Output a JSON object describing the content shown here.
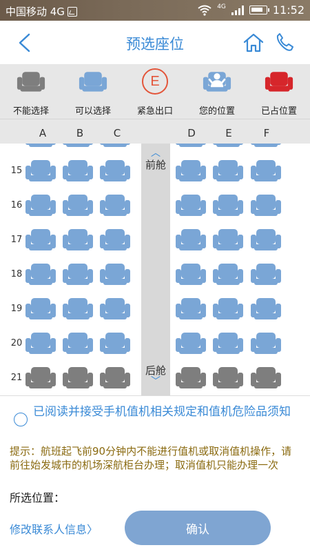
{
  "status_bar": {
    "carrier": "中国移动 4G",
    "network": "4G",
    "time": "11:52"
  },
  "header": {
    "title": "预选座位",
    "back_icon": "chevron-left-icon",
    "home_icon": "home-icon",
    "phone_icon": "phone-icon"
  },
  "legend": [
    {
      "label": "不能选择",
      "icon": "seat-gray-icon",
      "color": "#7e7e7e"
    },
    {
      "label": "可以选择",
      "icon": "seat-blue-icon",
      "color": "#7aa6d6"
    },
    {
      "label": "紧急出口",
      "icon": "exit-icon",
      "symbol": "E",
      "color": "#e3553a"
    },
    {
      "label": "您的位置",
      "icon": "seat-person-icon",
      "color": "#7aa6d6"
    },
    {
      "label": "已占位置",
      "icon": "seat-red-icon",
      "color": "#d6262b"
    }
  ],
  "columns": [
    "A",
    "B",
    "C",
    "D",
    "E",
    "F"
  ],
  "cabin": {
    "front_label": "前舱",
    "rear_label": "后舱"
  },
  "rows": [
    {
      "num": "15",
      "seats": [
        "available",
        "available",
        "available",
        "available",
        "available",
        "available"
      ]
    },
    {
      "num": "16",
      "seats": [
        "available",
        "available",
        "available",
        "available",
        "available",
        "available"
      ]
    },
    {
      "num": "17",
      "seats": [
        "available",
        "available",
        "available",
        "available",
        "available",
        "available"
      ]
    },
    {
      "num": "18",
      "seats": [
        "available",
        "available",
        "available",
        "available",
        "available",
        "available"
      ]
    },
    {
      "num": "19",
      "seats": [
        "available",
        "available",
        "available",
        "available",
        "available",
        "available"
      ]
    },
    {
      "num": "20",
      "seats": [
        "available",
        "available",
        "available",
        "available",
        "available",
        "available"
      ]
    },
    {
      "num": "21",
      "seats": [
        "unavailable",
        "unavailable",
        "unavailable",
        "unavailable",
        "unavailable",
        "unavailable"
      ]
    }
  ],
  "seat_colors": {
    "available": "#7aa6d6",
    "unavailable": "#7e7e7e"
  },
  "footer": {
    "agreement_text": "已阅读并接受手机值机相关规定和值机危险品须知",
    "tip_text": "提示：航班起飞前90分钟内不能进行值机或取消值机操作，请前往始发城市的机场深航柜台办理；取消值机只能办理一次",
    "selected_label": "所选位置：",
    "modify_link": "修改联系人信息",
    "confirm_label": "确认"
  }
}
